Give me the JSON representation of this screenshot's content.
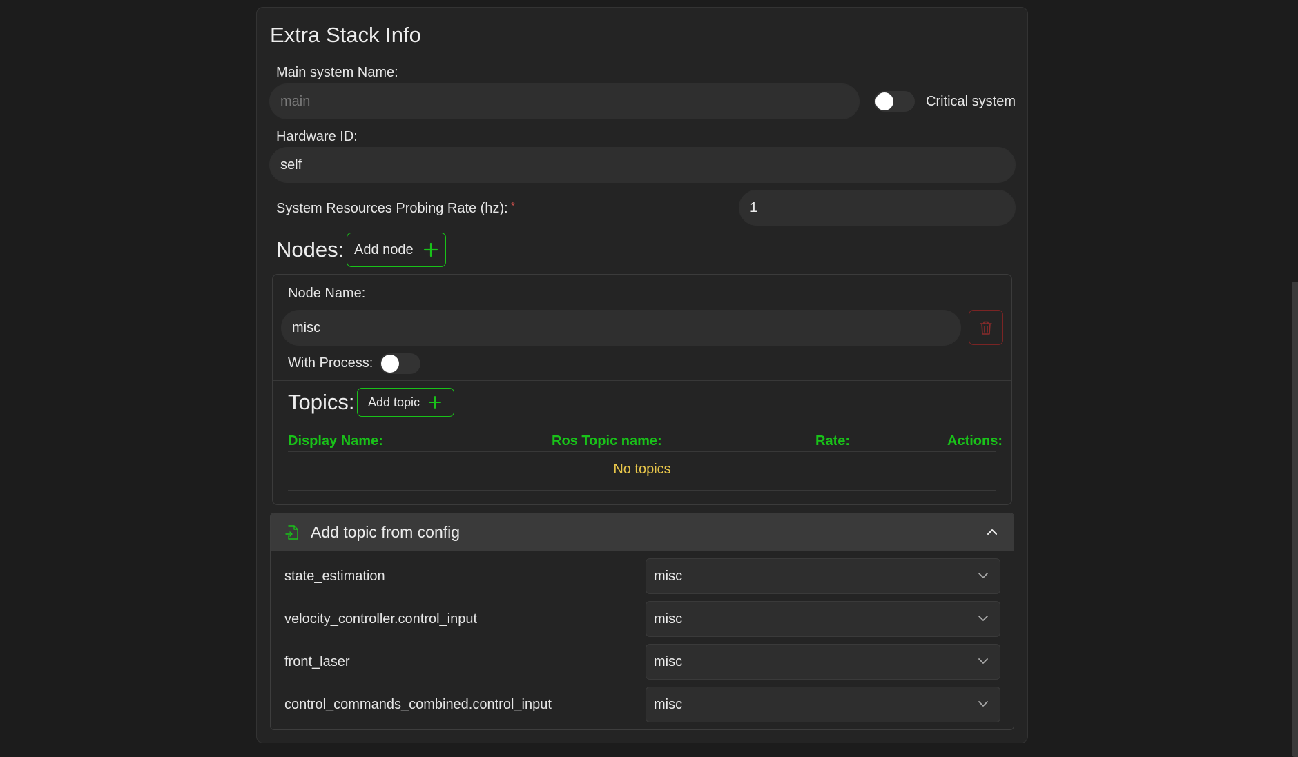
{
  "card": {
    "title": "Extra Stack Info"
  },
  "main_system": {
    "label": "Main system Name:",
    "placeholder": "main",
    "critical_label": "Critical system",
    "critical_on": false
  },
  "hardware": {
    "label": "Hardware ID:",
    "value": "self"
  },
  "probing": {
    "label": "System Resources Probing Rate (hz):",
    "required_mark": "*",
    "value": "1"
  },
  "nodes": {
    "title": "Nodes:",
    "add_label": "Add node",
    "node": {
      "name_label": "Node Name:",
      "name_value": "misc",
      "with_process_label": "With Process:",
      "with_process_on": false,
      "topics": {
        "title": "Topics:",
        "add_label": "Add topic",
        "columns": [
          "Display Name:",
          "Ros Topic name:",
          "Rate:",
          "Actions:"
        ],
        "empty_text": "No topics"
      }
    }
  },
  "config": {
    "title": "Add topic from config",
    "expanded": true,
    "rows": [
      {
        "topic": "state_estimation",
        "node": "misc"
      },
      {
        "topic": "velocity_controller.control_input",
        "node": "misc"
      },
      {
        "topic": "front_laser",
        "node": "misc"
      },
      {
        "topic": "control_commands_combined.control_input",
        "node": "misc"
      }
    ]
  },
  "colors": {
    "accent": "#19c219",
    "danger": "#7a2424",
    "warning": "#e8c64a",
    "background": "#1c1c1c",
    "card": "#242424"
  },
  "icons": [
    "plus-icon",
    "trash-icon",
    "file-import-icon",
    "chevron-up-icon",
    "chevron-down-icon"
  ]
}
